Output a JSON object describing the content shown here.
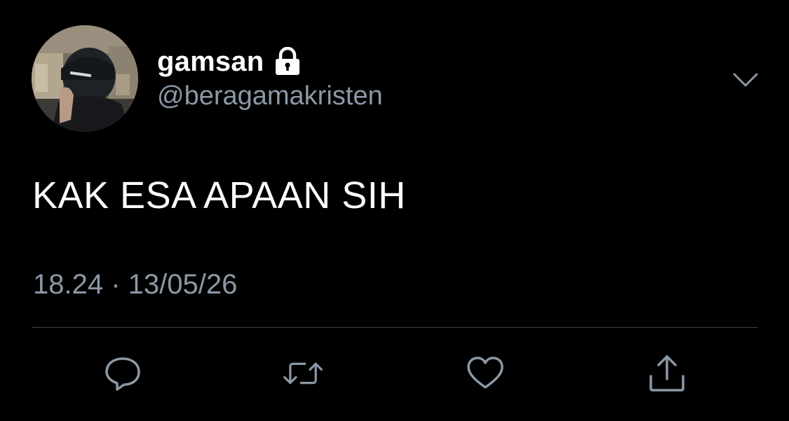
{
  "tweet": {
    "display_name": "gamsan",
    "handle": "@beragamakristen",
    "text": "KAK ESA APAAN SIH",
    "timestamp": "18.24 · 13/05/26",
    "protected": true
  },
  "icons": {
    "lock": "lock-icon",
    "more": "chevron-down-icon",
    "reply": "reply-icon",
    "retweet": "retweet-icon",
    "like": "heart-icon",
    "share": "share-icon"
  },
  "colors": {
    "background": "#000000",
    "primary_text": "#ffffff",
    "secondary_text": "#8b98a5",
    "icon": "#8b98a5",
    "divider": "#38444d"
  }
}
